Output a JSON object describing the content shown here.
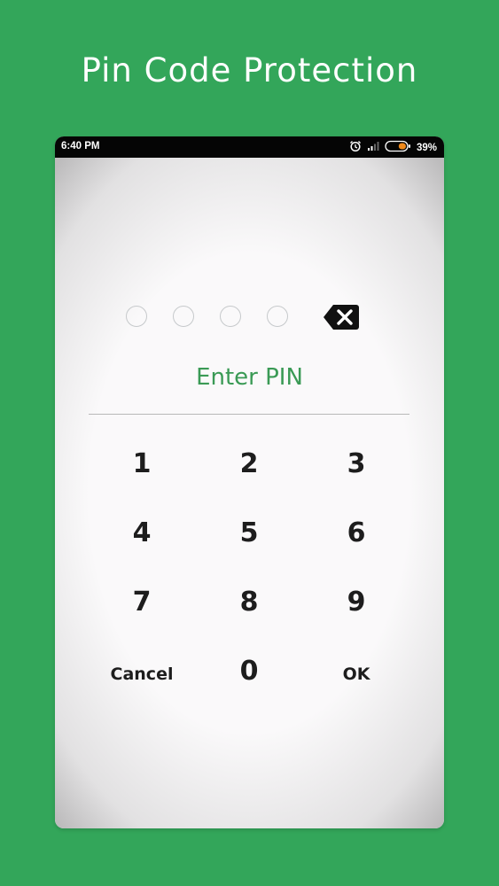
{
  "headline": "Pin Code Protection",
  "status_bar": {
    "time": "6:40 PM",
    "battery_percent": "39%",
    "battery_level": 0.39,
    "icons": [
      "alarm-icon",
      "signal-icon",
      "battery-icon"
    ]
  },
  "pin": {
    "length": 4,
    "entered": 0,
    "prompt": "Enter PIN"
  },
  "keypad": {
    "k1": "1",
    "k2": "2",
    "k3": "3",
    "k4": "4",
    "k5": "5",
    "k6": "6",
    "k7": "7",
    "k8": "8",
    "k9": "9",
    "cancel": "Cancel",
    "k0": "0",
    "ok": "OK"
  },
  "colors": {
    "background": "#33a65a",
    "accent_text": "#3a9a55",
    "battery_fill": "#f08a1c"
  }
}
